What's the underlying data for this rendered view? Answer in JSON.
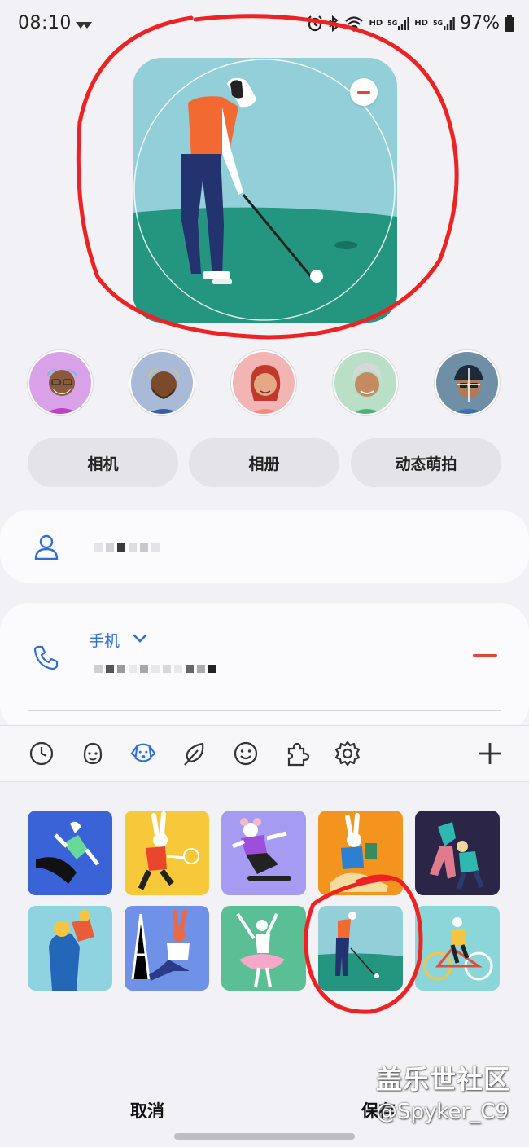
{
  "status_bar": {
    "time": "08:10",
    "network_labels": [
      "HD",
      "5G",
      "HD",
      "5G"
    ],
    "battery": "97%"
  },
  "preview": {
    "selected_sticker": "golfer",
    "remove_icon": "minus-circle-icon"
  },
  "avatars": [
    {
      "name": "avatar-elder-man",
      "bg": "#d9a2e8"
    },
    {
      "name": "avatar-bearded-man",
      "bg": "#a9b9d8"
    },
    {
      "name": "avatar-woman",
      "bg": "#f3b4b4"
    },
    {
      "name": "avatar-elder-woman",
      "bg": "#b9e0c6"
    },
    {
      "name": "avatar-man-cap",
      "bg": "#6f8fa6"
    }
  ],
  "source_buttons": {
    "camera": "相机",
    "gallery": "相册",
    "motion": "动态萌拍"
  },
  "contact": {
    "phone_label": "手机"
  },
  "sticker_tabs": [
    "clock-icon",
    "face-icon",
    "dog-icon",
    "leaf-icon",
    "smile-icon",
    "puzzle-icon",
    "gear-icon"
  ],
  "stickers": [
    {
      "name": "sticker-surfer",
      "bg": "#3a63d8"
    },
    {
      "name": "sticker-rabbit-badminton",
      "bg": "#f6c83a"
    },
    {
      "name": "sticker-mouse-skateboard",
      "bg": "#a59bf2"
    },
    {
      "name": "sticker-rabbit-reading",
      "bg": "#f2941e"
    },
    {
      "name": "sticker-dancers",
      "bg": "#2b2547"
    },
    {
      "name": "sticker-family",
      "bg": "#8fd3e0"
    },
    {
      "name": "sticker-rabbit-painter",
      "bg": "#6f92e8"
    },
    {
      "name": "sticker-ballerina",
      "bg": "#5bbf95"
    },
    {
      "name": "sticker-golfer",
      "bg": "#93cfd9"
    },
    {
      "name": "sticker-cyclist",
      "bg": "#8bd6d8"
    }
  ],
  "footer": {
    "cancel": "取消",
    "save": "保存"
  },
  "watermark": {
    "line1": "盖乐世社区",
    "line2": "@Spyker_C9"
  },
  "colors": {
    "accent_blue": "#2e6fd1",
    "danger_red": "#e2453a",
    "annotation_red": "#ee2222"
  }
}
